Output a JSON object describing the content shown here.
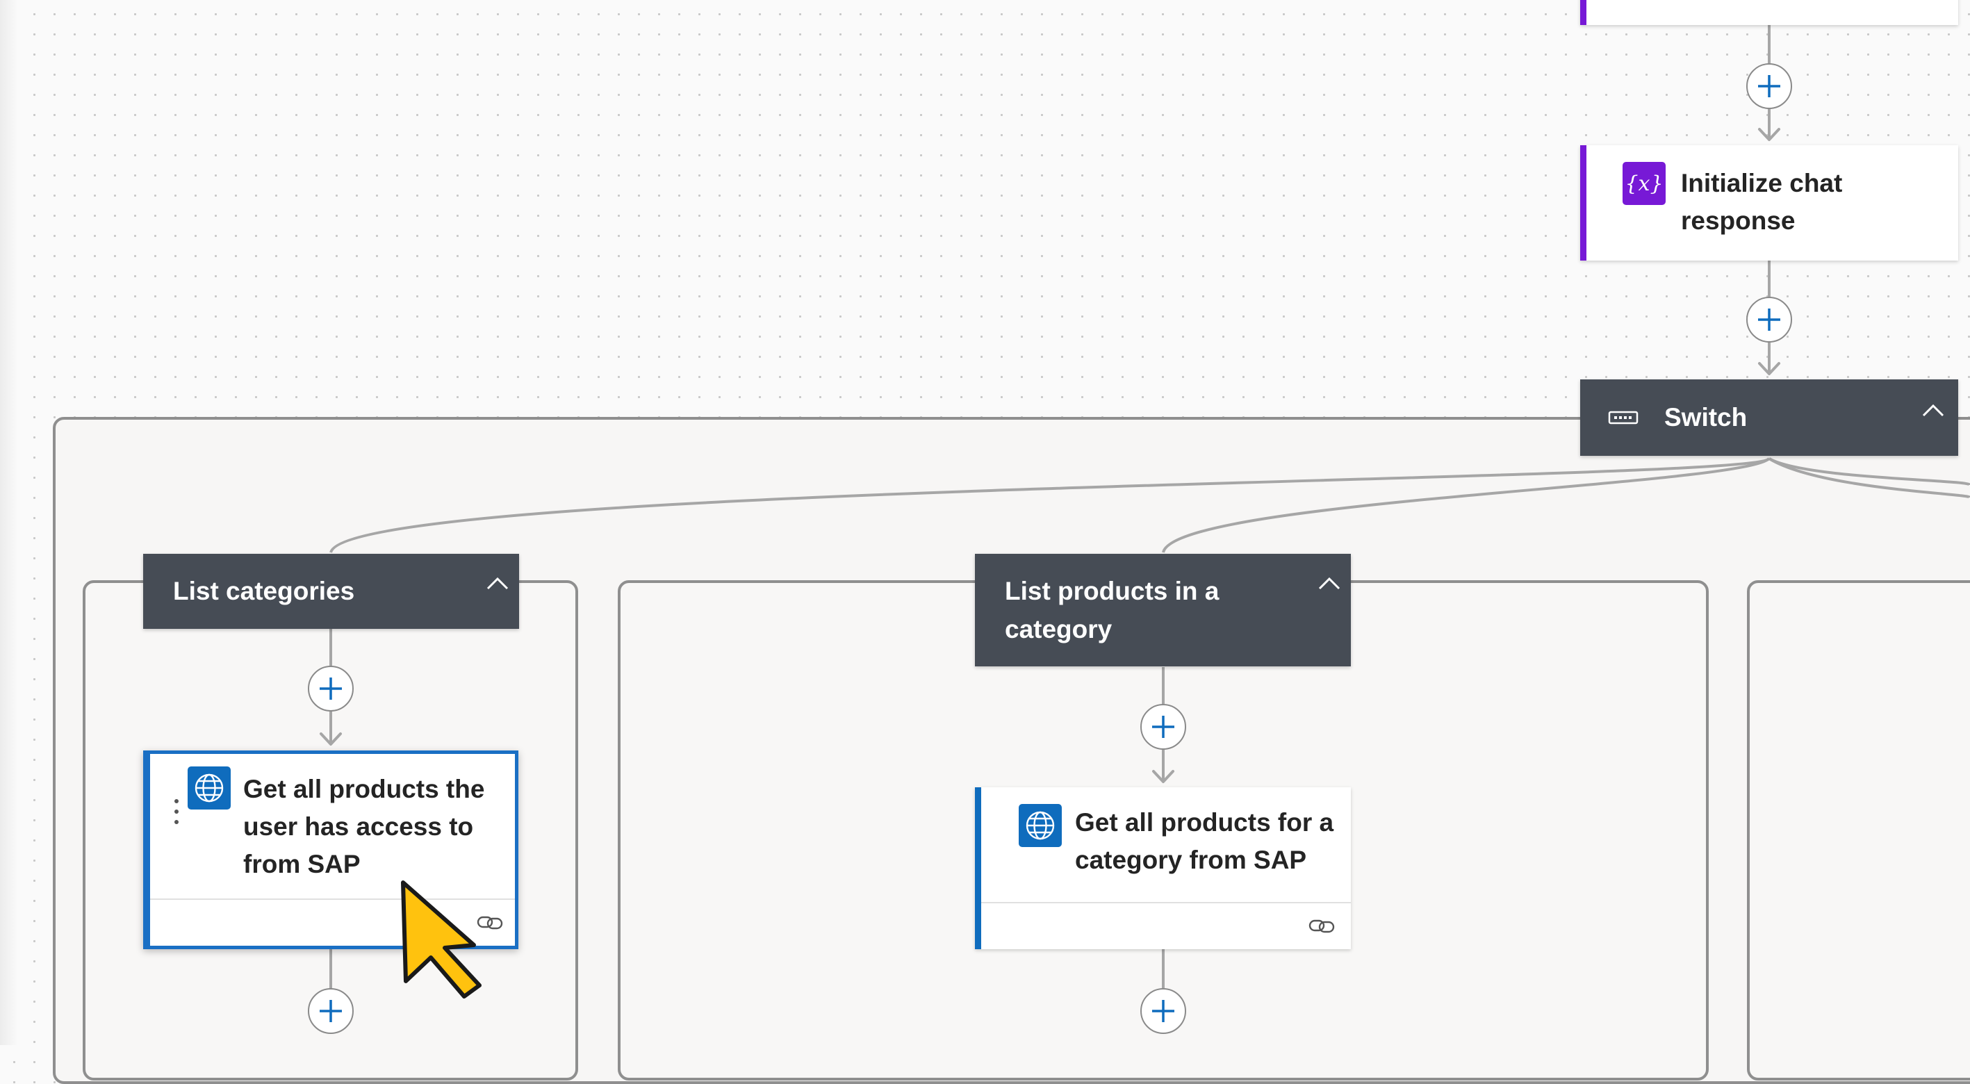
{
  "steps": {
    "initialize_chat": {
      "label": "Initialize chat response",
      "icon": "variable-icon"
    },
    "switch": {
      "label": "Switch",
      "icon": "switch-icon"
    }
  },
  "branches": [
    {
      "label": "List categories",
      "action": {
        "label": "Get all products the user has access to from SAP",
        "icon": "globe-icon",
        "selected": true
      }
    },
    {
      "label": "List products in a category",
      "action": {
        "label": "Get all products for a category from SAP",
        "icon": "globe-icon",
        "selected": false
      }
    }
  ],
  "colors": {
    "header": "#464c55",
    "accent_blue": "#0f6cbd",
    "accent_purple": "#7719d6",
    "cursor": "#ffc20e"
  }
}
